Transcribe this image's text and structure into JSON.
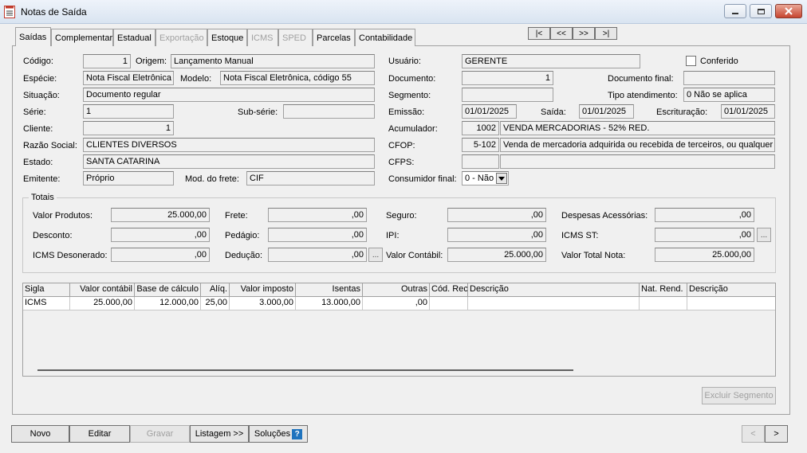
{
  "window": {
    "title": "Notas de Saída"
  },
  "tabs": [
    "Saídas",
    "Complementar",
    "Estadual",
    "Exportação",
    "Estoque",
    "ICMS",
    "SPED",
    "Parcelas",
    "Contabilidade"
  ],
  "nav": {
    "first": "|<",
    "prev": "<<",
    "next": ">>",
    "last": ">|"
  },
  "labels": {
    "codigo": "Código:",
    "origem": "Origem:",
    "especie": "Espécie:",
    "modelo": "Modelo:",
    "situacao": "Situação:",
    "serie": "Série:",
    "subserie": "Sub-série:",
    "cliente": "Cliente:",
    "razao": "Razão Social:",
    "estado": "Estado:",
    "emitente": "Emitente:",
    "frete_mod": "Mod. do frete:",
    "usuario": "Usuário:",
    "conferido": "Conferido",
    "documento": "Documento:",
    "documento_final": "Documento final:",
    "segmento": "Segmento:",
    "tipo_atendimento": "Tipo atendimento:",
    "emissao": "Emissão:",
    "saida": "Saída:",
    "escrituracao": "Escrituração:",
    "acumulador": "Acumulador:",
    "cfop": "CFOP:",
    "cfps": "CFPS:",
    "consumidor_final": "Consumidor final:",
    "totais": "Totais",
    "valor_produtos": "Valor Produtos:",
    "frete": "Frete:",
    "seguro": "Seguro:",
    "despesas": "Despesas Acessórias:",
    "desconto": "Desconto:",
    "pedagio": "Pedágio:",
    "ipi": "IPI:",
    "icms_st": "ICMS ST:",
    "icms_desonerado": "ICMS Desonerado:",
    "deducao": "Dedução:",
    "valor_contabil": "Valor Contábil:",
    "valor_total": "Valor Total Nota:"
  },
  "values": {
    "codigo": "1",
    "origem": "Lançamento Manual",
    "especie": "Nota Fiscal Eletrônica",
    "modelo": "Nota Fiscal Eletrônica, código 55",
    "situacao": "Documento regular",
    "serie": "1",
    "subserie": "",
    "cliente": "1",
    "razao": "CLIENTES DIVERSOS",
    "estado": "SANTA CATARINA",
    "emitente": "Próprio",
    "frete_mod": "CIF",
    "usuario": "GERENTE",
    "documento": "1",
    "documento_final": "",
    "segmento": "",
    "tipo_atendimento": "0 Não se aplica",
    "emissao": "01/01/2025",
    "saida": "01/01/2025",
    "escrituracao": "01/01/2025",
    "acumulador_cod": "1002",
    "acumulador_desc": "VENDA MERCADORIAS - 52% RED.",
    "cfop_cod": "5-102",
    "cfop_desc": "Venda de mercadoria adquirida ou recebida de terceiros, ou qualquer ve",
    "cfps_cod": "",
    "cfps_desc": "",
    "consumidor_final": "0 - Não",
    "valor_produtos": "25.000,00",
    "frete": ",00",
    "seguro": ",00",
    "despesas": ",00",
    "desconto": ",00",
    "pedagio": ",00",
    "ipi": ",00",
    "icms_st": ",00",
    "icms_desonerado": ",00",
    "deducao": ",00",
    "valor_contabil": "25.000,00",
    "valor_total": "25.000,00"
  },
  "grid": {
    "headers": [
      "Sigla",
      "Valor contábil",
      "Base de cálculo",
      "Alíq.",
      "Valor imposto",
      "Isentas",
      "Outras",
      "Cód. Rec.",
      "Descrição",
      "Nat. Rend.",
      "Descrição"
    ],
    "rows": [
      [
        "ICMS",
        "25.000,00",
        "12.000,00",
        "25,00",
        "3.000,00",
        "13.000,00",
        ",00",
        "",
        "",
        "",
        ""
      ]
    ]
  },
  "buttons": {
    "excluir_segmento": "Excluir Segmento",
    "novo": "Novo",
    "editar": "Editar",
    "gravar": "Gravar",
    "listagem": "Listagem >>",
    "solucoes": "Soluções",
    "prev": "<",
    "next": ">",
    "dots": "..."
  },
  "colors": {
    "titlebar": "#dce6f2",
    "close": "#c7452f",
    "help": "#1e73be"
  }
}
